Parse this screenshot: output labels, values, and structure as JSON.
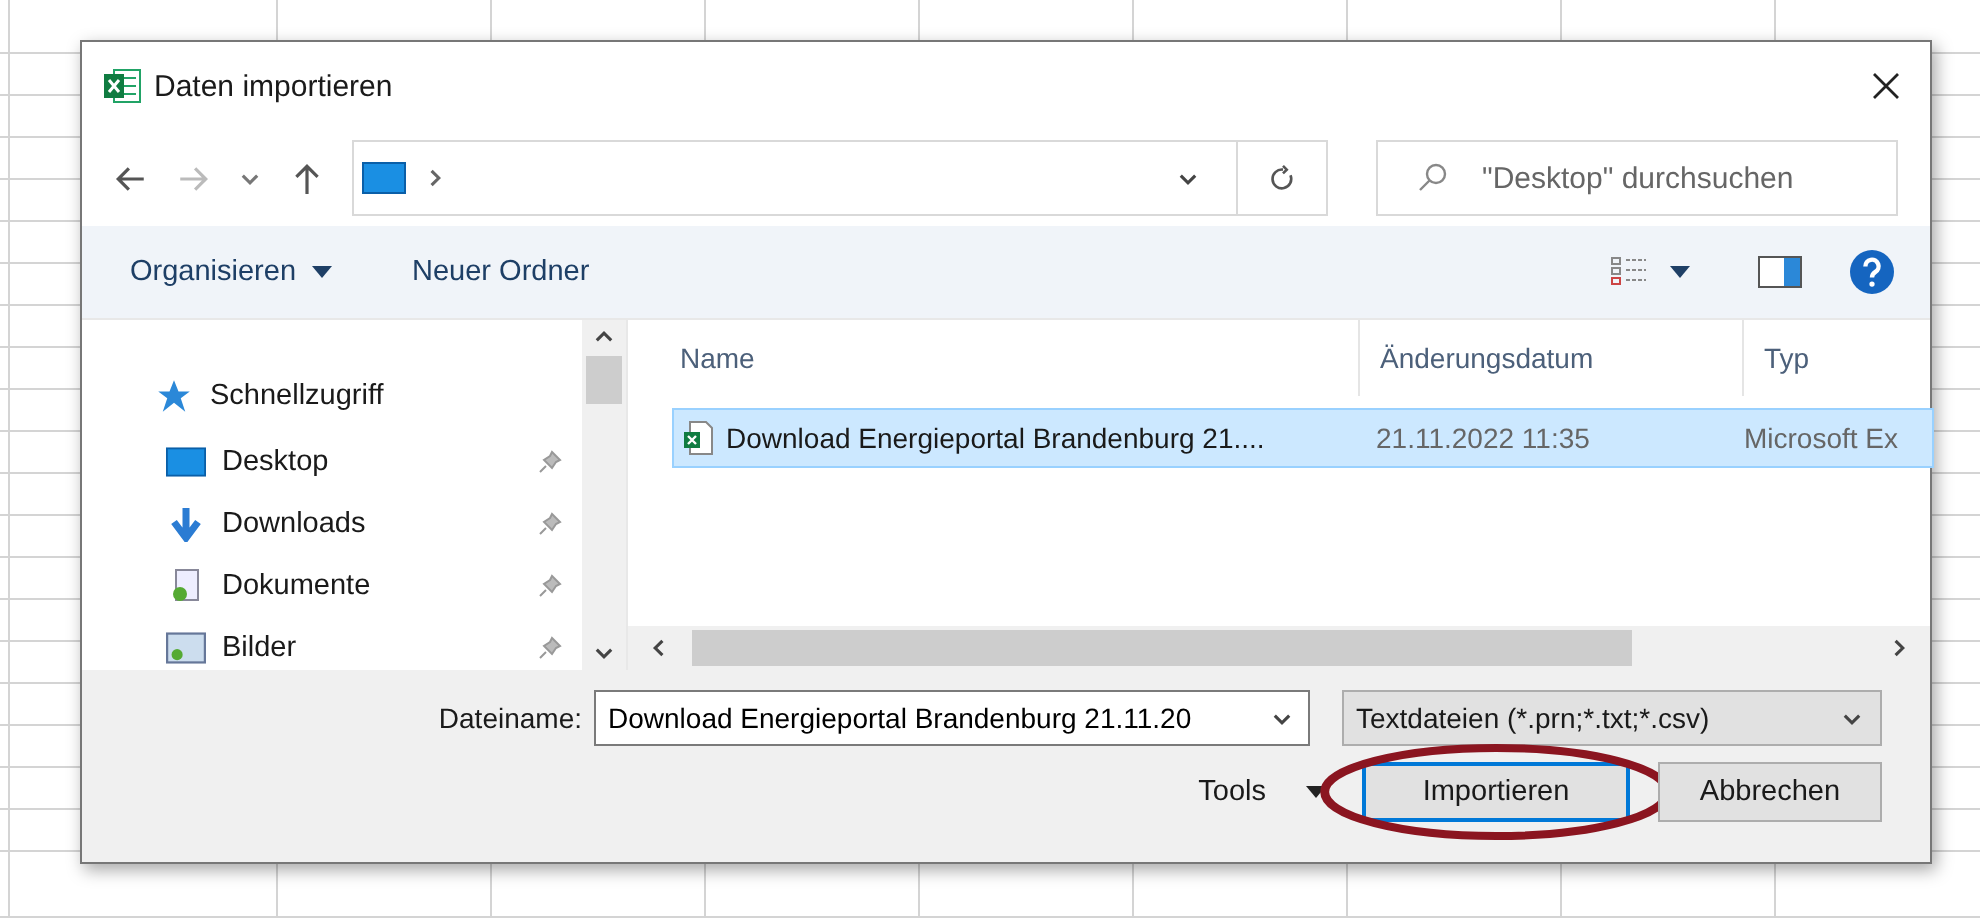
{
  "window": {
    "title": "Daten importieren"
  },
  "navigation": {
    "search_placeholder": "\"Desktop\" durchsuchen"
  },
  "toolbar": {
    "items": [
      "Organisieren",
      "Neuer Ordner"
    ]
  },
  "sidebar": {
    "items": [
      {
        "label": "Schnellzugriff",
        "kind": "group",
        "pinned": false
      },
      {
        "label": "Desktop",
        "kind": "place",
        "pinned": true
      },
      {
        "label": "Downloads",
        "kind": "place",
        "pinned": true
      },
      {
        "label": "Dokumente",
        "kind": "place",
        "pinned": true
      },
      {
        "label": "Bilder",
        "kind": "place",
        "pinned": true
      }
    ]
  },
  "file_list": {
    "columns": [
      "Name",
      "Änderungsdatum",
      "Typ"
    ],
    "rows": [
      {
        "name": "Download Energieportal Brandenburg 21....",
        "date": "21.11.2022 11:35",
        "type": "Microsoft Ex",
        "selected": true
      }
    ]
  },
  "footer": {
    "filename_label": "Dateiname:",
    "filename_value": "Download Energieportal Brandenburg 21.11.20",
    "filetype": "Textdateien (*.prn;*.txt;*.csv)",
    "tools": "Tools",
    "buttons": [
      {
        "label": "Importieren",
        "highlighted": true
      },
      {
        "label": "Abbrechen",
        "highlighted": false
      }
    ]
  }
}
